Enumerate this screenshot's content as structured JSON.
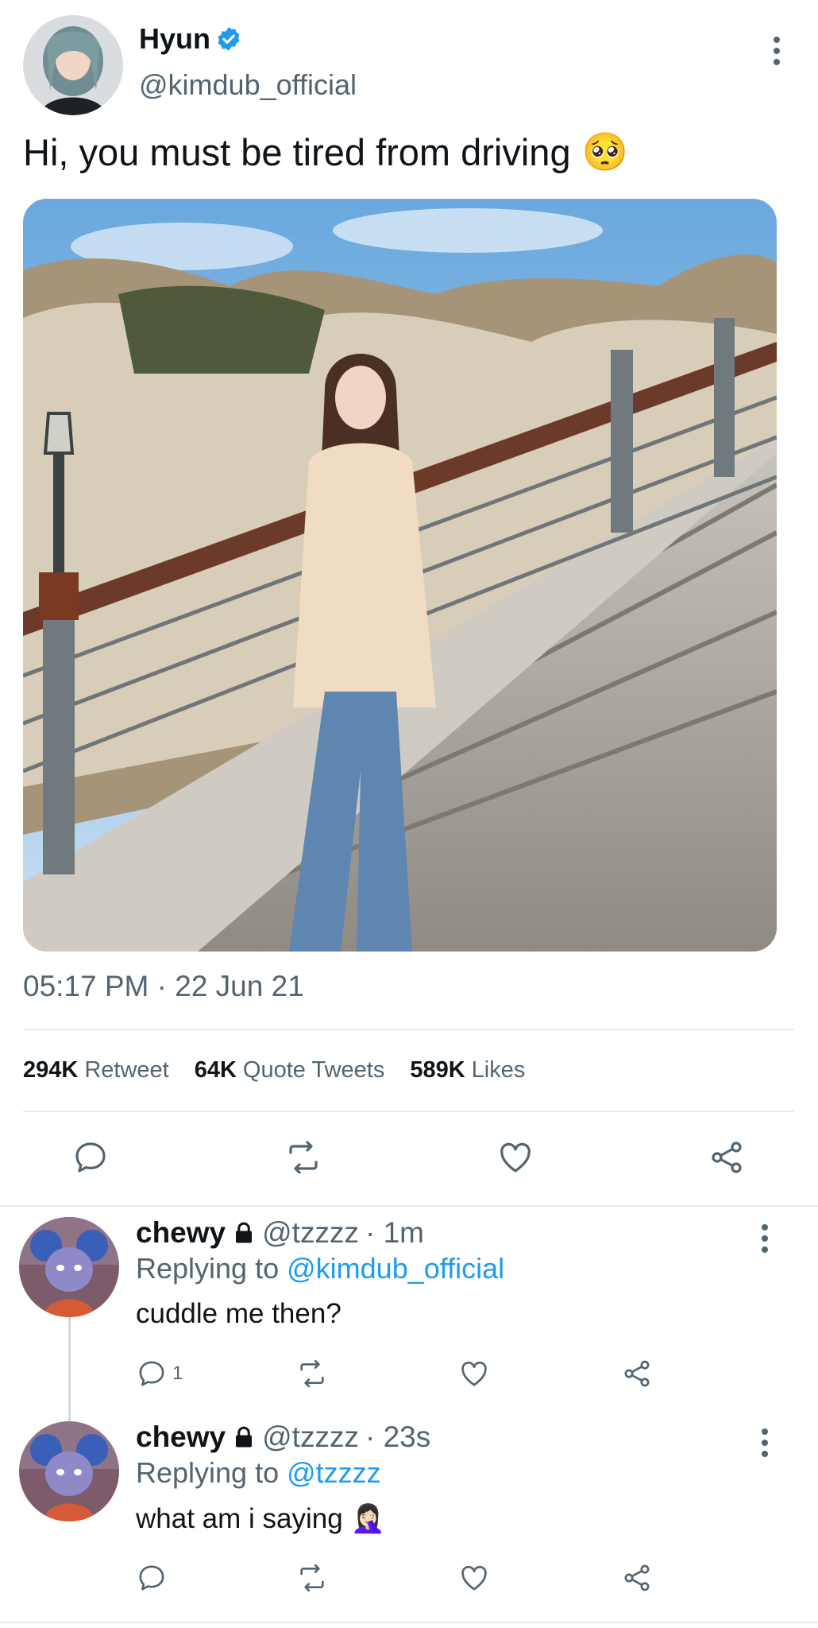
{
  "tweet": {
    "author_name": "Hyun",
    "author_handle": "@kimdub_official",
    "text": "Hi, you must be tired from driving",
    "text_emoji": "🥺",
    "timestamp": "05:17 PM · 22 Jun 21",
    "stats": [
      {
        "count": "294K",
        "label": "Retweet"
      },
      {
        "count": "64K",
        "label": "Quote Tweets"
      },
      {
        "count": "589K",
        "label": "Likes"
      }
    ]
  },
  "replies": [
    {
      "name": "chewy",
      "handle": "@tzzzz",
      "time": "· 1m",
      "replying_prefix": "Replying to",
      "replying_to": "@kimdub_official",
      "text": "cuddle me then?",
      "text_emoji": "",
      "reply_count": "1"
    },
    {
      "name": "chewy",
      "handle": "@tzzzz",
      "time": "· 23s",
      "replying_prefix": "Replying to",
      "replying_to": "@tzzzz",
      "text": "what am i saying",
      "text_emoji": "🤦🏻‍♀️",
      "reply_count": ""
    }
  ],
  "icons": {
    "verified": "verified-badge-icon",
    "lock": "lock-icon",
    "reply": "reply-icon",
    "retweet": "retweet-icon",
    "like": "like-icon",
    "share": "share-icon",
    "more": "more-icon"
  },
  "colors": {
    "accent": "#1d9bf0",
    "muted": "#536471",
    "text": "#0f1419"
  }
}
